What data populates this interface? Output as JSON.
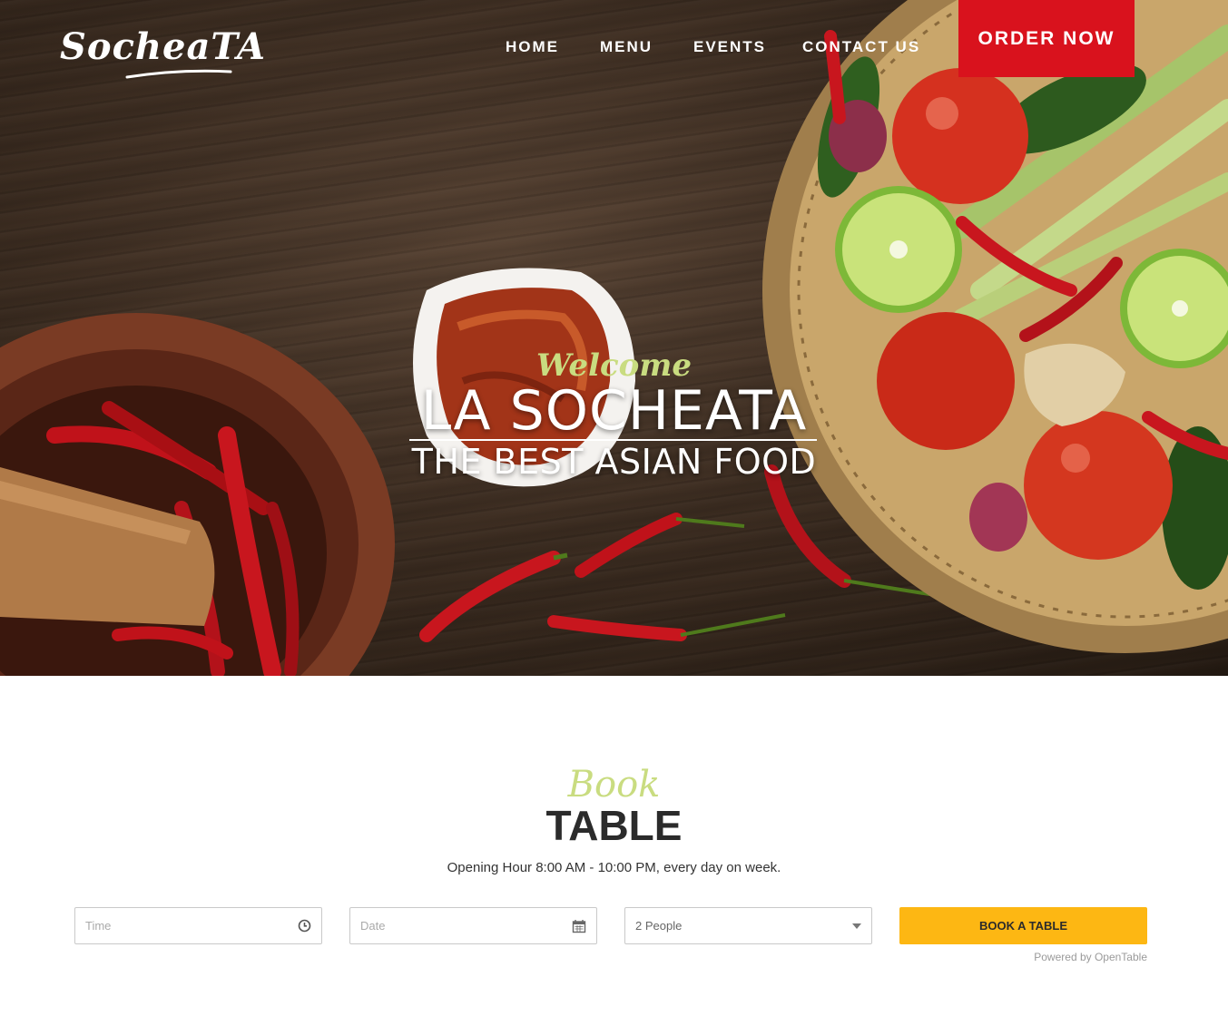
{
  "brand": {
    "logo_text": "SocheaTA"
  },
  "nav": {
    "items": [
      {
        "label": "HOME"
      },
      {
        "label": "MENU"
      },
      {
        "label": "EVENTS"
      },
      {
        "label": "CONTACT US"
      }
    ],
    "cta_label": "ORDER NOW"
  },
  "hero": {
    "welcome": "Welcome",
    "title": "LA SOCHEATA",
    "subtitle": "THE BEST ASIAN FOOD"
  },
  "booking": {
    "script_title": "Book",
    "title": "TABLE",
    "hours": "Opening Hour 8:00 AM - 10:00 PM, every day on week.",
    "time_placeholder": "Time",
    "date_placeholder": "Date",
    "people_value": "2 People",
    "submit_label": "BOOK A TABLE",
    "powered_by": "Powered by OpenTable"
  },
  "colors": {
    "order_button": "#d9121d",
    "book_button": "#fdb713",
    "script_accent": "#c9dc80",
    "heading": "#2b2b2b"
  },
  "icons": [
    "clock-icon",
    "calendar-icon",
    "chevron-down-icon"
  ]
}
